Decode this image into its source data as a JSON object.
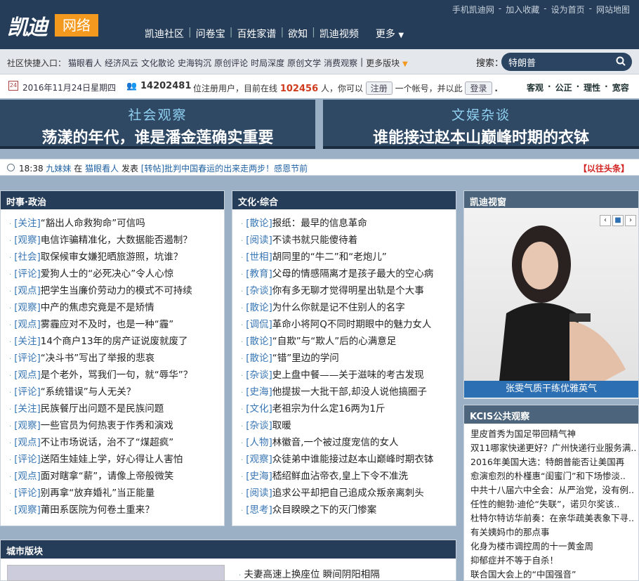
{
  "logo": {
    "main": "凯迪",
    "badge": "网络"
  },
  "top_nav": [
    "凯迪社区",
    "问卷宝",
    "百姓家谱",
    "欲知",
    "凯迪视频"
  ],
  "top_nav_more": "更多",
  "top_links": [
    "手机凯迪网",
    "加入收藏",
    "设为首页",
    "网站地图"
  ],
  "quick": {
    "label": "社区快捷入口：",
    "links": [
      "猫眼看人",
      "经济风云",
      "文化散论",
      "史海钩沉",
      "原创评论",
      "时局深度",
      "原创文学",
      "消费观察"
    ],
    "more": "更多版块"
  },
  "search": {
    "label": "搜索：",
    "value": "特朗普"
  },
  "status": {
    "date": "2016年11月24日星期四",
    "registered": "14202481",
    "text1": "位注册用户，目前在线",
    "online": "102456",
    "text2": "人，你可以",
    "register": "注册",
    "text3": "一个帐号，并以此",
    "login": "登录",
    "values": [
      "客观",
      "公正",
      "理性",
      "宽容"
    ]
  },
  "banners": [
    {
      "category": "社会观察",
      "headline": "荡漾的年代，谁是潘金莲确实重要"
    },
    {
      "category": "文娱杂谈",
      "headline": "谁能接过赵本山巅峰时期的衣钵"
    }
  ],
  "ticker": {
    "time": "18:38",
    "user": "九妹妹",
    "in": "在",
    "board": "猫眼看人",
    "posted": "发表",
    "title": "[转帖]批判中国春运的出来走两步！感恩节前",
    "old": "【以往头条】"
  },
  "politics": {
    "title": "时事·政治",
    "items": [
      {
        "tag": "[关注]",
        "text": "“豁出人命救狗命”可信吗"
      },
      {
        "tag": "[观察]",
        "text": "电信诈骗精准化，大数据能否遏制？"
      },
      {
        "tag": "[社会]",
        "text": "取保候审女嫌犯晒旅游照，坑谁？"
      },
      {
        "tag": "[评论]",
        "text": "爱狗人士的“必死决心”令人心惊"
      },
      {
        "tag": "[观点]",
        "text": "把学生当廉价劳动力的模式不可持续"
      },
      {
        "tag": "[观察]",
        "text": "中产的焦虑究竟是不是矫情"
      },
      {
        "tag": "[观点]",
        "text": "雾霾应对不及时，也是一种“霾”"
      },
      {
        "tag": "[关注]",
        "text": "14个商户13年的房产证说废就废了"
      },
      {
        "tag": "[评论]",
        "text": "“决斗书”写出了举报的悲哀"
      },
      {
        "tag": "[观点]",
        "text": "是个老外，骂我们一句，就“辱华”？"
      },
      {
        "tag": "[评论]",
        "text": "“系统错误”与人无关？"
      },
      {
        "tag": "[关注]",
        "text": "民族餐厅出问题不是民族问题"
      },
      {
        "tag": "[观察]",
        "text": "一些官员为何热衷于作秀和演戏"
      },
      {
        "tag": "[观点]",
        "text": "不让市场说话，治不了“煤超疯”"
      },
      {
        "tag": "[评论]",
        "text": "送陌生娃娃上学，好心得让人害怕"
      },
      {
        "tag": "[观点]",
        "text": "面对瞎拿“薪”，请像上帝般微笑"
      },
      {
        "tag": "[评论]",
        "text": "别再拿“放弃婚礼”当正能量"
      },
      {
        "tag": "[观察]",
        "text": "莆田系医院为何卷土重来？"
      }
    ]
  },
  "culture": {
    "title": "文化·综合",
    "items": [
      {
        "tag": "[散论]",
        "text": "报纸：最早的信息革命"
      },
      {
        "tag": "[阅读]",
        "text": "不读书就只能傻待着"
      },
      {
        "tag": "[世相]",
        "text": "胡同里的“牛二”和“老炮儿”"
      },
      {
        "tag": "[教育]",
        "text": "父母的情感隔离才是孩子最大的空心病"
      },
      {
        "tag": "[杂谈]",
        "text": "你有多无聊才觉得明星出轨是个大事"
      },
      {
        "tag": "[散论]",
        "text": "为什么你就是记不住别人的名字"
      },
      {
        "tag": "[调侃]",
        "text": "革命小将阿Q不同时期眼中的魅力女人"
      },
      {
        "tag": "[散论]",
        "text": "“自欺”与“欺人”后的心满意足"
      },
      {
        "tag": "[散论]",
        "text": "“错”里边的学问"
      },
      {
        "tag": "[杂谈]",
        "text": "史上盘中餐——关于滋味的考古发现"
      },
      {
        "tag": "[史海]",
        "text": "他提拔一大批干部,却没人说他搞圈子"
      },
      {
        "tag": "[文化]",
        "text": "老祖宗为什么定16两为1斤"
      },
      {
        "tag": "[杂谈]",
        "text": "取暖"
      },
      {
        "tag": "[人物]",
        "text": "林徽音,一个被过度宠信的女人"
      },
      {
        "tag": "[观察]",
        "text": "众徒弟中谁能接过赵本山巅峰时期衣钵"
      },
      {
        "tag": "[史海]",
        "text": "嵇绍鲜血沾帝衣,皇上下令不准洗"
      },
      {
        "tag": "[阅读]",
        "text": "追求公平却把自己追成众叛亲离刺头"
      },
      {
        "tag": "[思考]",
        "text": "众目睽睽之下的灭门惨案"
      }
    ]
  },
  "window": {
    "title": "凯迪视窗",
    "caption": "张雯气质干练优雅英气",
    "nav": [
      "‹",
      "■",
      "›"
    ]
  },
  "kcis": {
    "title": "KCIS公共观察",
    "items": [
      "里皮首秀为国足带回精气神",
      "双11哪家快递更好？广州快递行业服务满..",
      "2016年美国大选：特朗普能否让美国再",
      "愈演愈烈的朴槿惠“闺蜜门”和下场惨淡..",
      "中共十八届六中全会：从严治党，没有例..",
      "任性的鲍勃·迪伦“失联”，诺贝尔奖该..",
      "杜特尔特访华前奏：在亲华疏美表象下寻..",
      "有关姨妈巾的那点事",
      "化身为楼市调控周的十一黄金周",
      "抑郁症并不等于自杀！",
      "联合国大会上的“中国强音”"
    ]
  },
  "city": {
    "title": "城市版块",
    "first_item": "夫妻高速上换座位 瞬间阴阳相隔"
  },
  "colors": {
    "header": "#253d59",
    "accent": "#f39a1e",
    "tag": "#3876b4",
    "online": "#d13b1d"
  }
}
